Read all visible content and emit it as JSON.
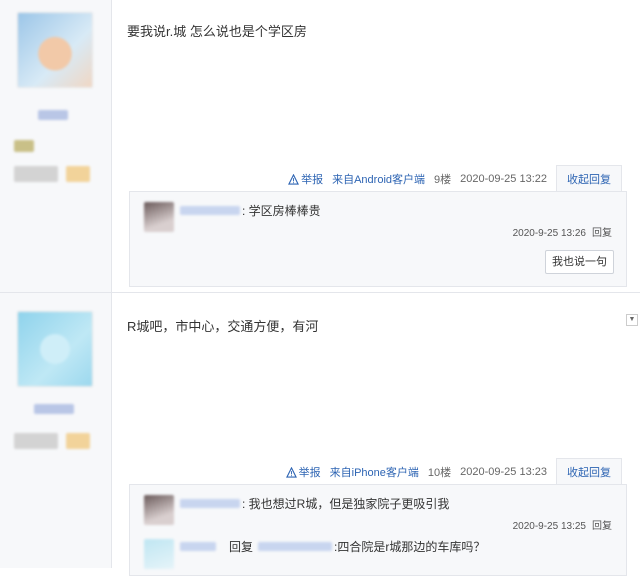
{
  "posts": [
    {
      "content": "要我说r.城 怎么说也是个学区房",
      "tail": {
        "report": "举报",
        "source": "来自Android客户端",
        "floor": "9楼",
        "time": "2020-09-25 13:22",
        "collapse": "收起回复"
      },
      "replies": [
        {
          "text": ": 学区房棒棒贵",
          "time": "2020-9-25 13:26",
          "reply": "回复"
        }
      ],
      "say_button": "我也说一句"
    },
    {
      "content": "R城吧，市中心，交通方便，有河",
      "tail": {
        "report": "举报",
        "source": "来自iPhone客户端",
        "floor": "10楼",
        "time": "2020-09-25 13:23",
        "collapse": "收起回复"
      },
      "replies": [
        {
          "text": ": 我也想过R城，但是独家院子更吸引我",
          "time": "2020-9-25 13:25",
          "reply": "回复"
        },
        {
          "mid": "回复",
          "text": ":四合院是r城那边的车库吗？"
        }
      ]
    }
  ],
  "icons": {
    "report": "warning-triangle-icon",
    "scroll": "scroll-down-arrow-icon"
  }
}
